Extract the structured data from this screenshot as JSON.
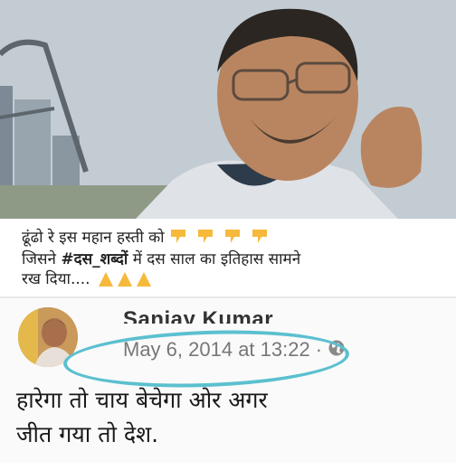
{
  "caption": {
    "line1_prefix": "ढूंढो रे इस महान हस्ती को",
    "line2_prefix": "जिसने",
    "hashtag": "#दस_शब्दों",
    "line2_suffix": "में  दस साल का इतिहास सामने",
    "line3": "रख दिया....",
    "pointing_emoji": "👇",
    "folded_hands_emoji": "🙏"
  },
  "post": {
    "author": "Sanjay Kumar",
    "timestamp": "May 6, 2014 at 13:22",
    "separator": "·",
    "body_line1": "हारेगा तो चाय बेचेगा ओर अगर",
    "body_line2": "जीत गया तो देश."
  },
  "colors": {
    "highlight_ring": "#5bc0cf",
    "emoji_yellow": "#f6b93b"
  }
}
